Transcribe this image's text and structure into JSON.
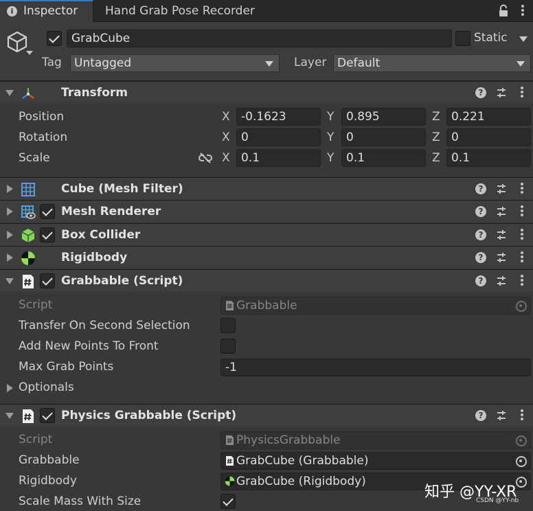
{
  "tabs": {
    "inspector": "Inspector",
    "second": "Hand Grab Pose Recorder"
  },
  "header": {
    "object_name": "GrabCube",
    "active": true,
    "static_label": "Static",
    "static": false,
    "tag_label": "Tag",
    "tag_value": "Untagged",
    "layer_label": "Layer",
    "layer_value": "Default"
  },
  "transform": {
    "title": "Transform",
    "rows": [
      {
        "label": "Position",
        "x": "-0.1623",
        "y": "0.895",
        "z": "0.221"
      },
      {
        "label": "Rotation",
        "x": "0",
        "y": "0",
        "z": "0"
      },
      {
        "label": "Scale",
        "x": "0.1",
        "y": "0.1",
        "z": "0.1"
      }
    ],
    "axes": {
      "x": "X",
      "y": "Y",
      "z": "Z"
    }
  },
  "components": {
    "mesh_filter": "Cube (Mesh Filter)",
    "mesh_renderer": "Mesh Renderer",
    "box_collider": "Box Collider",
    "rigidbody": "Rigidbody"
  },
  "grabbable": {
    "title": "Grabbable (Script)",
    "script_label": "Script",
    "script_value": "Grabbable",
    "transfer_label": "Transfer On Second Selection",
    "transfer": false,
    "add_front_label": "Add New Points To Front",
    "add_front": false,
    "max_points_label": "Max Grab Points",
    "max_points_value": "-1",
    "optionals_label": "Optionals"
  },
  "physics_grabbable": {
    "title": "Physics Grabbable (Script)",
    "script_label": "Script",
    "script_value": "PhysicsGrabbable",
    "grabbable_label": "Grabbable",
    "grabbable_value": "GrabCube (Grabbable)",
    "rigidbody_label": "Rigidbody",
    "rigidbody_value": "GrabCube (Rigidbody)",
    "scale_mass_label": "Scale Mass With Size",
    "scale_mass": true
  },
  "watermark": {
    "main": "知乎 @YY-XR",
    "small": "CSDN @YY-nb"
  },
  "colors": {
    "background": "#383838",
    "tabbar": "#282828",
    "field": "#2a2a2a",
    "accent_tab": "#3a79bb",
    "script_icon": "#8bc34a"
  }
}
